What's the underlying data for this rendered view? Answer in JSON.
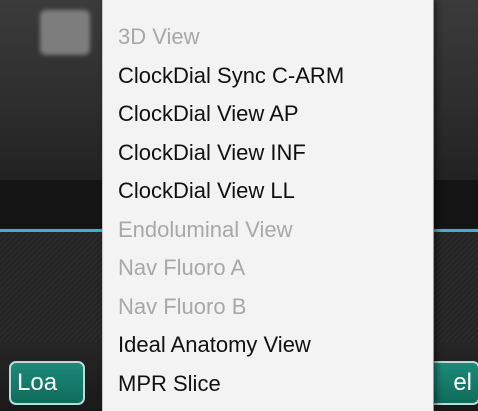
{
  "menu": {
    "items": [
      {
        "label": "3D View",
        "enabled": false
      },
      {
        "label": "ClockDial Sync C-ARM",
        "enabled": true
      },
      {
        "label": "ClockDial View AP",
        "enabled": true
      },
      {
        "label": "ClockDial View INF",
        "enabled": true
      },
      {
        "label": "ClockDial View LL",
        "enabled": true
      },
      {
        "label": "Endoluminal View",
        "enabled": false
      },
      {
        "label": "Nav Fluoro A",
        "enabled": false
      },
      {
        "label": "Nav Fluoro B",
        "enabled": false
      },
      {
        "label": "Ideal Anatomy View",
        "enabled": true
      },
      {
        "label": "MPR Slice",
        "enabled": true
      }
    ]
  },
  "footer": {
    "load_label": "Loa",
    "cancel_label": "el"
  },
  "colors": {
    "accent": "#38b6c6",
    "button_green": "#137a6a",
    "menu_background": "#f3f3f3",
    "disabled_text": "#a8a8a8"
  }
}
